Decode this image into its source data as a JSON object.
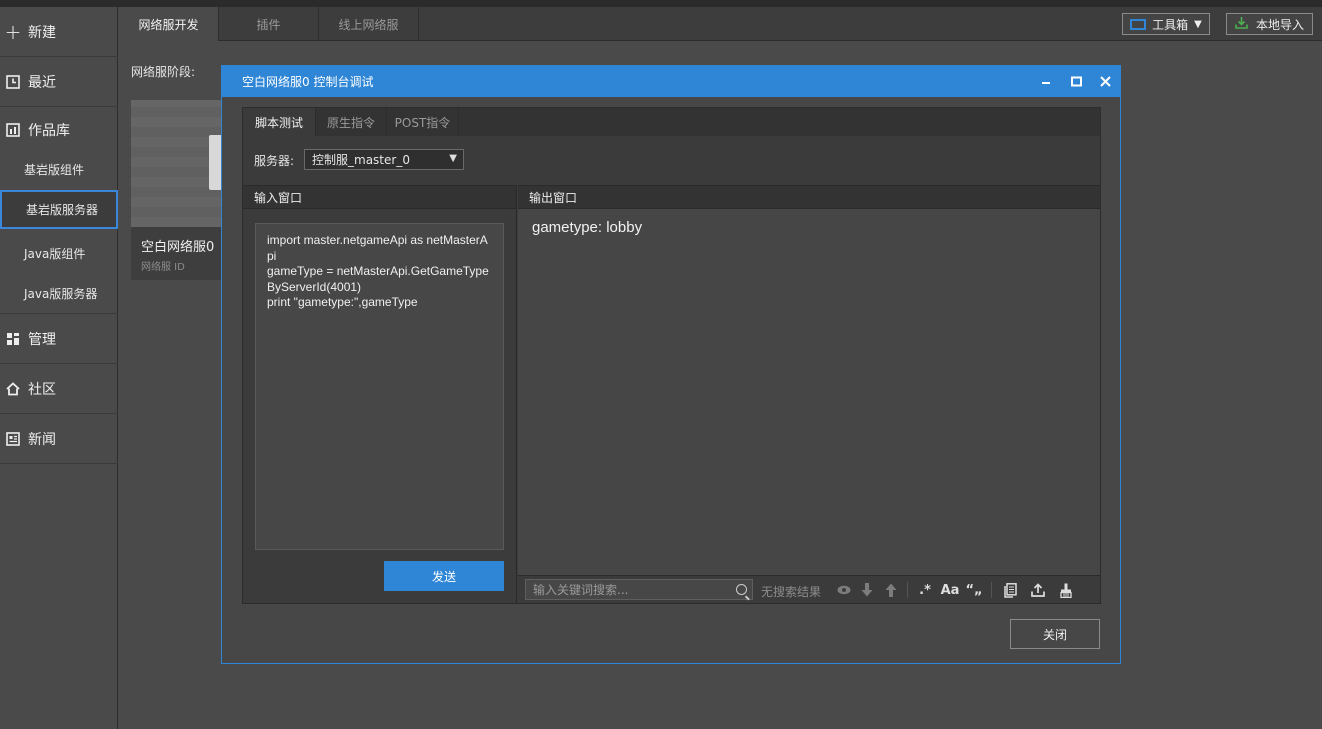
{
  "sidebar": {
    "new": "新建",
    "recent": "最近",
    "works": "作品库",
    "sub_items": [
      "基岩版组件",
      "基岩版服务器",
      "Java版组件",
      "Java版服务器"
    ],
    "manage": "管理",
    "community": "社区",
    "news": "新闻"
  },
  "tabs": [
    "网络服开发",
    "插件",
    "线上网络服"
  ],
  "toolbar": {
    "toolbox": "工具箱",
    "local_import": "本地导入"
  },
  "main": {
    "stage_label": "网络服阶段:",
    "card_title": "空白网络服0",
    "card_sub": "网络服 ID"
  },
  "dialog": {
    "title": "空白网络服0 控制台调试",
    "tabs": [
      "脚本测试",
      "原生指令",
      "POST指令"
    ],
    "server_label": "服务器:",
    "server_value": "控制服_master_0",
    "input_header": "输入窗口",
    "output_header": "输出窗口",
    "code": "import master.netgameApi as netMasterApi\ngameType = netMasterApi.GetGameTypeByServerId(4001)\nprint \"gametype:\",gameType",
    "output": "gametype: lobby",
    "send": "发送",
    "search_placeholder": "输入关键词搜索...",
    "no_result": "无搜索结果",
    "regex_label": ".*",
    "case_label": "Aa",
    "quote_label": "“„",
    "close": "关闭"
  }
}
